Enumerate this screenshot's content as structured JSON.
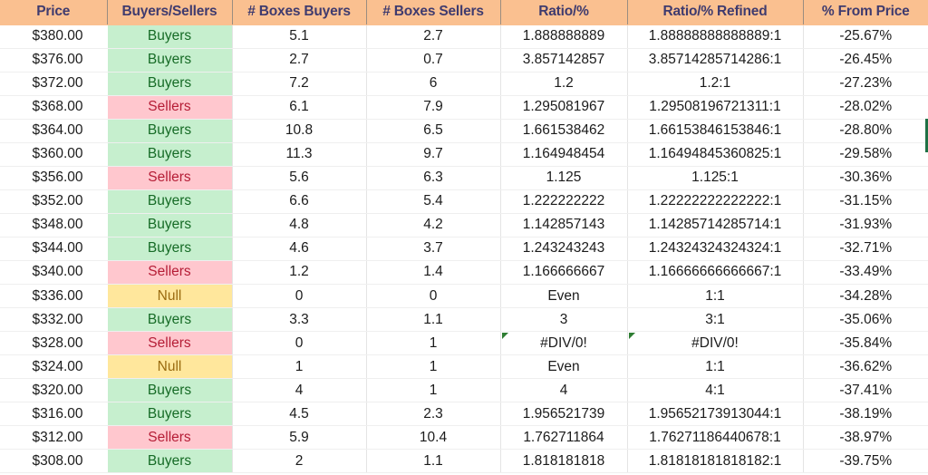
{
  "spreadsheet": {
    "headers": [
      "Price",
      "Buyers/Sellers",
      "# Boxes Buyers",
      "# Boxes Sellers",
      "Ratio/%",
      "Ratio/% Refined",
      "% From Price"
    ],
    "colors": {
      "header_bg": "#FAC090",
      "header_text": "#3F3B6E",
      "buyers_bg": "#C6EFCE",
      "buyers_text": "#166B26",
      "sellers_bg": "#FFC7CE",
      "sellers_text": "#B51D36",
      "null_bg": "#FFE79C",
      "null_text": "#9A6B10",
      "error_triangle": "#2E7D32",
      "range_edge": "#1E7145"
    },
    "rows": [
      {
        "price": "$380.00",
        "status": "Buyers",
        "boxes_buyers": "5.1",
        "boxes_sellers": "2.7",
        "ratio": "1.888888889",
        "refined": "1.88888888888889:1",
        "from_price": "-25.67%",
        "error": false
      },
      {
        "price": "$376.00",
        "status": "Buyers",
        "boxes_buyers": "2.7",
        "boxes_sellers": "0.7",
        "ratio": "3.857142857",
        "refined": "3.85714285714286:1",
        "from_price": "-26.45%",
        "error": false
      },
      {
        "price": "$372.00",
        "status": "Buyers",
        "boxes_buyers": "7.2",
        "boxes_sellers": "6",
        "ratio": "1.2",
        "refined": "1.2:1",
        "from_price": "-27.23%",
        "error": false
      },
      {
        "price": "$368.00",
        "status": "Sellers",
        "boxes_buyers": "6.1",
        "boxes_sellers": "7.9",
        "ratio": "1.295081967",
        "refined": "1.29508196721311:1",
        "from_price": "-28.02%",
        "error": false
      },
      {
        "price": "$364.00",
        "status": "Buyers",
        "boxes_buyers": "10.8",
        "boxes_sellers": "6.5",
        "ratio": "1.661538462",
        "refined": "1.66153846153846:1",
        "from_price": "-28.80%",
        "error": false
      },
      {
        "price": "$360.00",
        "status": "Buyers",
        "boxes_buyers": "11.3",
        "boxes_sellers": "9.7",
        "ratio": "1.164948454",
        "refined": "1.16494845360825:1",
        "from_price": "-29.58%",
        "error": false
      },
      {
        "price": "$356.00",
        "status": "Sellers",
        "boxes_buyers": "5.6",
        "boxes_sellers": "6.3",
        "ratio": "1.125",
        "refined": "1.125:1",
        "from_price": "-30.36%",
        "error": false
      },
      {
        "price": "$352.00",
        "status": "Buyers",
        "boxes_buyers": "6.6",
        "boxes_sellers": "5.4",
        "ratio": "1.222222222",
        "refined": "1.22222222222222:1",
        "from_price": "-31.15%",
        "error": false
      },
      {
        "price": "$348.00",
        "status": "Buyers",
        "boxes_buyers": "4.8",
        "boxes_sellers": "4.2",
        "ratio": "1.142857143",
        "refined": "1.14285714285714:1",
        "from_price": "-31.93%",
        "error": false
      },
      {
        "price": "$344.00",
        "status": "Buyers",
        "boxes_buyers": "4.6",
        "boxes_sellers": "3.7",
        "ratio": "1.243243243",
        "refined": "1.24324324324324:1",
        "from_price": "-32.71%",
        "error": false
      },
      {
        "price": "$340.00",
        "status": "Sellers",
        "boxes_buyers": "1.2",
        "boxes_sellers": "1.4",
        "ratio": "1.166666667",
        "refined": "1.16666666666667:1",
        "from_price": "-33.49%",
        "error": false
      },
      {
        "price": "$336.00",
        "status": "Null",
        "boxes_buyers": "0",
        "boxes_sellers": "0",
        "ratio": "Even",
        "refined": "1:1",
        "from_price": "-34.28%",
        "error": false
      },
      {
        "price": "$332.00",
        "status": "Buyers",
        "boxes_buyers": "3.3",
        "boxes_sellers": "1.1",
        "ratio": "3",
        "refined": "3:1",
        "from_price": "-35.06%",
        "error": false
      },
      {
        "price": "$328.00",
        "status": "Sellers",
        "boxes_buyers": "0",
        "boxes_sellers": "1",
        "ratio": "#DIV/0!",
        "refined": "#DIV/0!",
        "from_price": "-35.84%",
        "error": true
      },
      {
        "price": "$324.00",
        "status": "Null",
        "boxes_buyers": "1",
        "boxes_sellers": "1",
        "ratio": "Even",
        "refined": "1:1",
        "from_price": "-36.62%",
        "error": false
      },
      {
        "price": "$320.00",
        "status": "Buyers",
        "boxes_buyers": "4",
        "boxes_sellers": "1",
        "ratio": "4",
        "refined": "4:1",
        "from_price": "-37.41%",
        "error": false
      },
      {
        "price": "$316.00",
        "status": "Buyers",
        "boxes_buyers": "4.5",
        "boxes_sellers": "2.3",
        "ratio": "1.956521739",
        "refined": "1.95652173913044:1",
        "from_price": "-38.19%",
        "error": false
      },
      {
        "price": "$312.00",
        "status": "Sellers",
        "boxes_buyers": "5.9",
        "boxes_sellers": "10.4",
        "ratio": "1.762711864",
        "refined": "1.76271186440678:1",
        "from_price": "-38.97%",
        "error": false
      },
      {
        "price": "$308.00",
        "status": "Buyers",
        "boxes_buyers": "2",
        "boxes_sellers": "1.1",
        "ratio": "1.818181818",
        "refined": "1.81818181818182:1",
        "from_price": "-39.75%",
        "error": false
      }
    ]
  }
}
